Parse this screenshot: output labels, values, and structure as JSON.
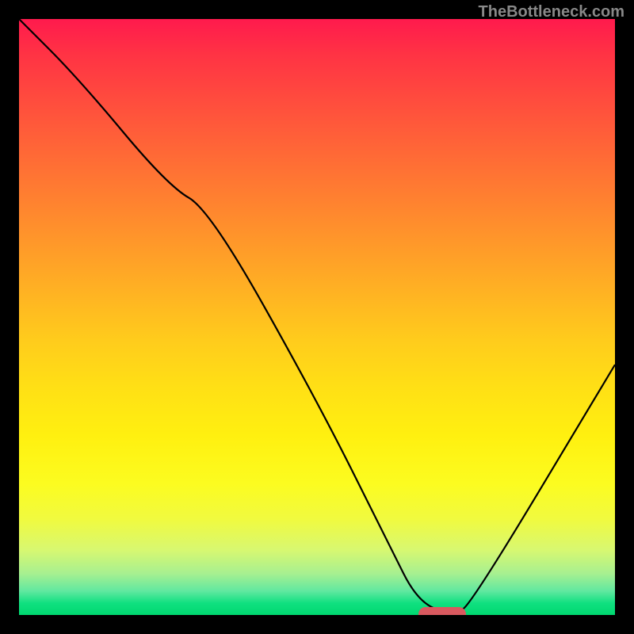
{
  "watermark": "TheBottleneck.com",
  "chart_data": {
    "type": "line",
    "title": "",
    "xlabel": "",
    "ylabel": "",
    "xlim": [
      0,
      100
    ],
    "ylim": [
      0,
      100
    ],
    "series": [
      {
        "name": "bottleneck-curve",
        "x": [
          0,
          10,
          25,
          32,
          50,
          62,
          67,
          73,
          76,
          100
        ],
        "values": [
          100,
          90,
          72,
          68,
          36,
          12,
          2,
          0,
          2,
          42
        ]
      }
    ],
    "marker": {
      "x_start": 67,
      "x_end": 75,
      "y": 0
    },
    "background": "red-yellow-green-vertical-gradient"
  }
}
